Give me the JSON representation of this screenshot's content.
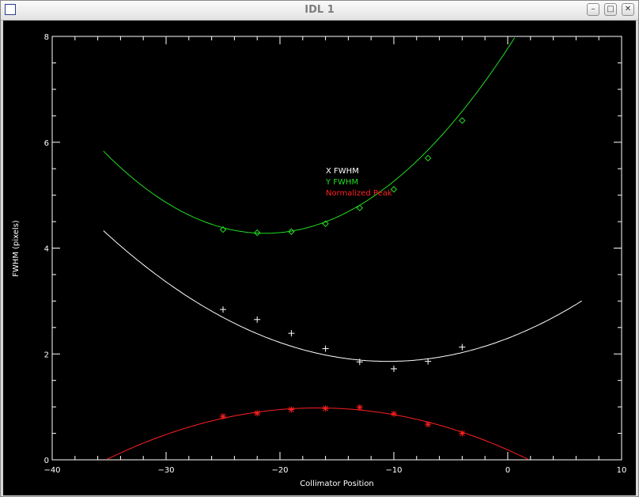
{
  "window": {
    "title": "IDL 1",
    "min_glyph": "–",
    "max_glyph": "□",
    "close_glyph": "✕"
  },
  "chart_data": {
    "type": "scatter",
    "xlabel": "Collimator Position",
    "ylabel": "FWHM (pixels)",
    "xlim": [
      -40,
      10
    ],
    "ylim": [
      0,
      8
    ],
    "xticks": [
      -40,
      -30,
      -20,
      -10,
      0,
      10
    ],
    "xtick_labels": [
      "−40",
      "−30",
      "−20",
      "−10",
      "0",
      "10"
    ],
    "yticks": [
      0,
      2,
      4,
      6,
      8
    ],
    "ytick_labels": [
      "0",
      "2",
      "4",
      "6",
      "8"
    ],
    "background": "#000000",
    "legend_position": "center",
    "series": [
      {
        "name": "X FWHM",
        "color": "#ffffff",
        "marker": "plus",
        "x": [
          -25,
          -22,
          -19,
          -16,
          -13,
          -10,
          -7,
          -4
        ],
        "y": [
          2.84,
          2.65,
          2.39,
          2.1,
          1.85,
          1.72,
          1.86,
          2.13
        ],
        "fit_x_range": [
          -35.5,
          6.5
        ],
        "fit_coeffs": [
          1.86,
          -10.5,
          0.00395
        ]
      },
      {
        "name": "Y FWHM",
        "color": "#22dd22",
        "marker": "diamond",
        "x": [
          -25,
          -22,
          -19,
          -16,
          -13,
          -10,
          -7,
          -4
        ],
        "y": [
          4.35,
          4.29,
          4.31,
          4.46,
          4.76,
          5.11,
          5.7,
          6.41
        ],
        "fit_x_range": [
          -35.5,
          2.5
        ],
        "fit_coeffs": [
          4.28,
          -21.3,
          0.0077
        ]
      },
      {
        "name": "Normalized Peak",
        "color": "#ff2020",
        "marker": "asterisk",
        "x": [
          -25,
          -22,
          -19,
          -16,
          -13,
          -10,
          -7,
          -4
        ],
        "y": [
          0.82,
          0.88,
          0.95,
          0.97,
          0.99,
          0.87,
          0.67,
          0.5
        ],
        "fit_x_range": [
          -35.2,
          1.8
        ],
        "fit_coeffs": [
          0.98,
          -16.7,
          -0.00284
        ]
      }
    ]
  }
}
